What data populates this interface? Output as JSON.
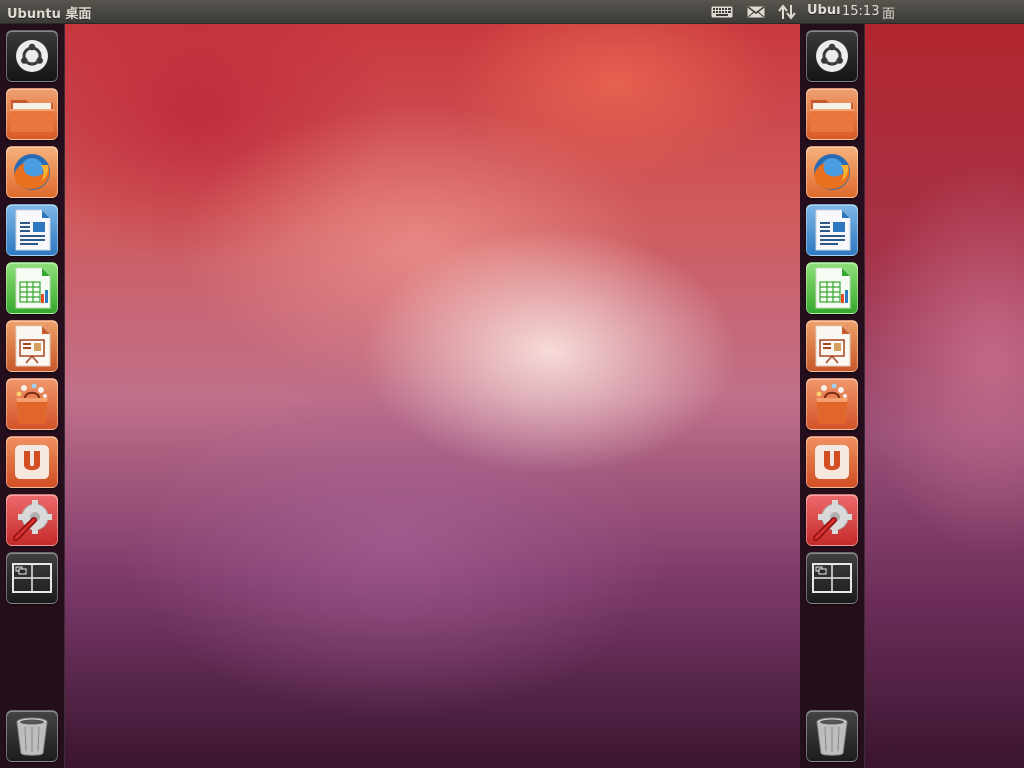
{
  "top_panel": {
    "title_left": "Ubuntu 桌面",
    "title_right": "Ubuı",
    "clock": "15:13",
    "title_cut": "面",
    "icons": [
      "keyboard-icon",
      "mail-icon",
      "network-arrows-icon"
    ]
  },
  "launcher": {
    "items": [
      {
        "name": "dash-home-icon",
        "tooltip": ""
      },
      {
        "name": "files-folder-icon",
        "tooltip": ""
      },
      {
        "name": "firefox-icon",
        "tooltip": ""
      },
      {
        "name": "libreoffice-writer-icon",
        "tooltip": ""
      },
      {
        "name": "libreoffice-calc-icon",
        "tooltip": ""
      },
      {
        "name": "libreoffice-impress-icon",
        "tooltip": ""
      },
      {
        "name": "software-center-icon",
        "tooltip": ""
      },
      {
        "name": "ubuntu-one-icon",
        "tooltip": ""
      },
      {
        "name": "system-settings-icon",
        "tooltip": ""
      },
      {
        "name": "workspace-switcher-icon",
        "tooltip": ""
      },
      {
        "name": "trash-icon",
        "tooltip": ""
      }
    ]
  },
  "colors": {
    "panel_bg": "#3c3b37",
    "launcher_bg": "#26101c",
    "wallpaper_top": "#c8383e",
    "wallpaper_bottom": "#3a1530",
    "ubuntu_orange": "#dd4814"
  }
}
